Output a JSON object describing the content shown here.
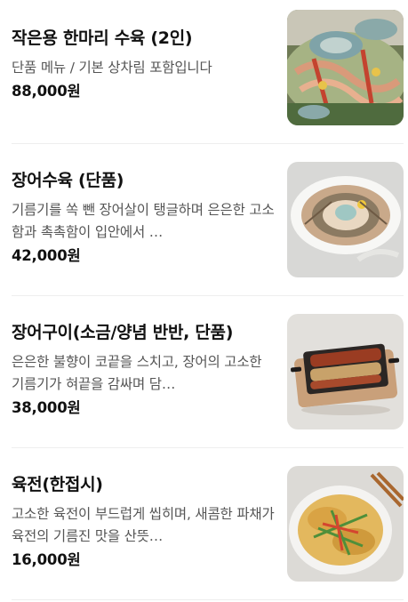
{
  "menu": {
    "items": [
      {
        "name": "작은용 한마리 수육 (2인)",
        "description": "단품 메뉴 / 기본 상차림 포함입니다",
        "price": "88,000원",
        "image": "eel-platter-photo"
      },
      {
        "name": "장어수육 (단품)",
        "description": "기름기를 쏙 뺀 장어살이 탱글하며 은은한 고소함과 촉촉함이 입안에서 …",
        "price": "42,000원",
        "image": "eel-boiled-plate-photo"
      },
      {
        "name": "장어구이(소금/양념 반반, 단품)",
        "description": "은은한 불향이 코끝을 스치고, 장어의 고소한 기름기가 혀끝을 감싸며 담…",
        "price": "38,000원",
        "image": "grilled-eel-grill-photo"
      },
      {
        "name": "육전(한접시)",
        "description": "고소한 육전이 부드럽게 씹히며, 새콤한 파채가 육전의 기름진 맛을 산뜻…",
        "price": "16,000원",
        "image": "beef-jeon-plate-photo"
      }
    ]
  },
  "colors": {
    "text": "#111111",
    "description": "#555555",
    "divider": "#eeeeee",
    "background": "#ffffff"
  }
}
